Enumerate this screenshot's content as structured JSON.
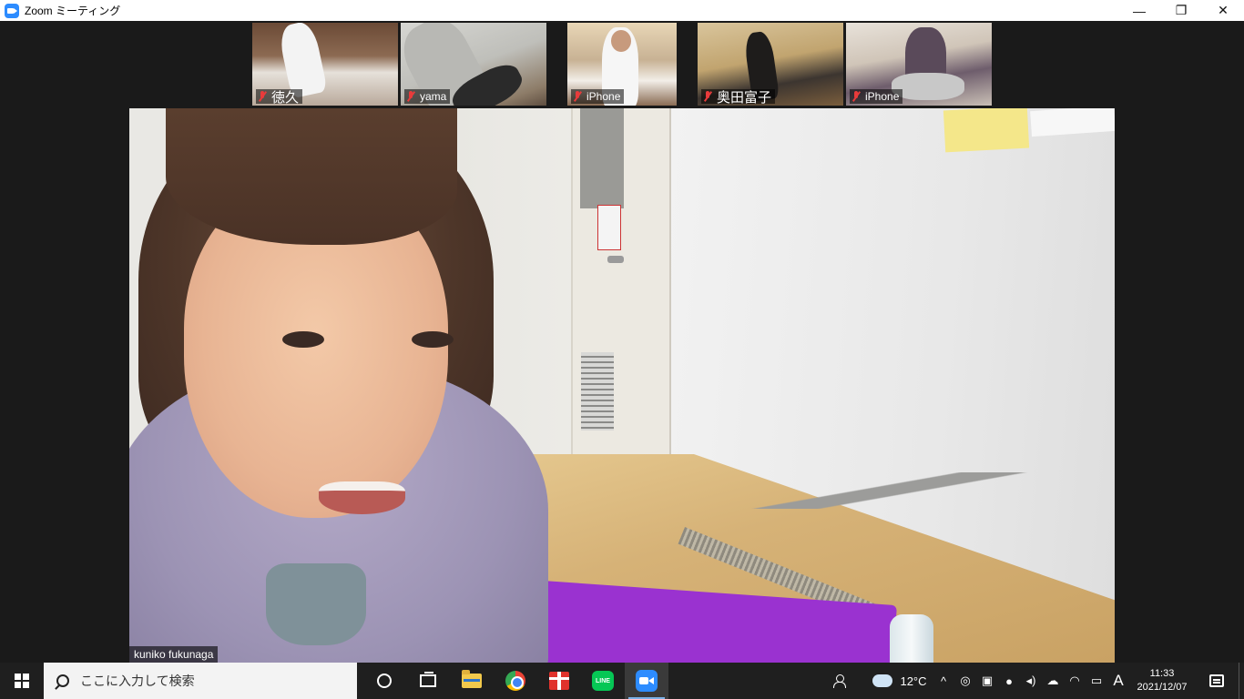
{
  "window": {
    "title": "Zoom ミーティング",
    "controls": {
      "minimize": "—",
      "restore": "❐",
      "close": "✕"
    }
  },
  "gallery": [
    {
      "name": "徳久",
      "muted": true
    },
    {
      "name": "yama",
      "muted": true
    },
    {
      "name": "iPhone",
      "muted": true
    },
    {
      "name": "奥田富子",
      "muted": true
    },
    {
      "name": "iPhone",
      "muted": true
    }
  ],
  "active_speaker": {
    "name": "kuniko fukunaga"
  },
  "taskbar": {
    "search_placeholder": "ここに入力して検索",
    "apps": [
      "cortana-icon",
      "task-view-icon",
      "file-explorer-icon",
      "chrome-icon",
      "gift-icon",
      "line-icon",
      "zoom-icon"
    ],
    "line_text": "LINE",
    "tray": {
      "temperature": "12°C",
      "chevron": "^",
      "ime": "A",
      "time": "11:33",
      "date": "2021/12/07"
    }
  }
}
